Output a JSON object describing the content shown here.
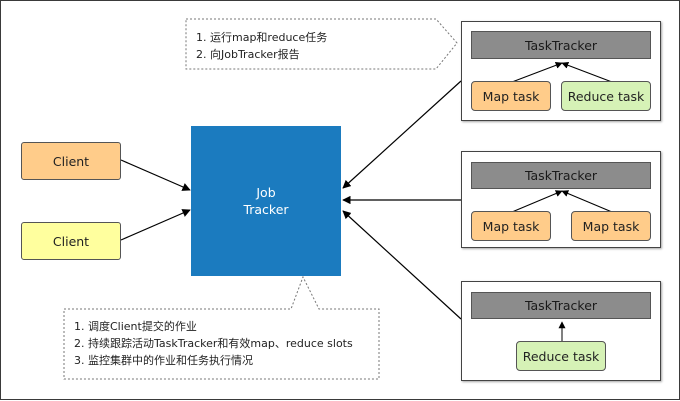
{
  "clients": [
    "Client",
    "Client"
  ],
  "jobtracker": {
    "line1": "Job",
    "line2": "Tracker"
  },
  "tasktrackers": [
    {
      "title": "TaskTracker",
      "tasks": [
        "Map task",
        "Reduce task"
      ]
    },
    {
      "title": "TaskTracker",
      "tasks": [
        "Map task",
        "Map task"
      ]
    },
    {
      "title": "TaskTracker",
      "tasks": [
        "Reduce task"
      ]
    }
  ],
  "note_tasktracker": [
    "1. 运行map和reduce任务",
    "2. 向JobTracker报告"
  ],
  "note_jobtracker": [
    "1. 调度Client提交的作业",
    "2. 持续跟踪活动TaskTracker和有效map、reduce slots",
    "3. 监控集群中的作业和任务执行情况"
  ],
  "colors": {
    "jobtracker": "#1b7bbf",
    "client_orange": "#ffcc8a",
    "client_yellow": "#ffff9e",
    "map_task": "#ffcc8a",
    "reduce_task": "#d6f2b6",
    "tasktracker_header": "#8c8c8c"
  }
}
